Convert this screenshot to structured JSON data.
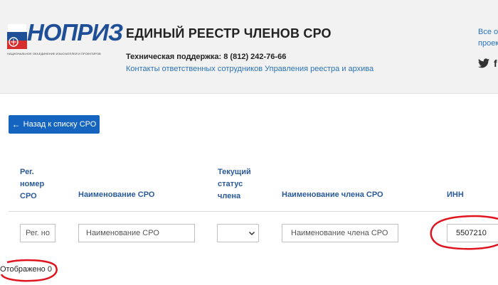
{
  "header": {
    "logo": {
      "wordmark": "НОПРИЗ",
      "subtitle": "НАЦИОНАЛЬНОЕ ОБЪЕДИНЕНИЕ ИЗЫСКАТЕЛЕЙ И ПРОЕКТИРОВЩИКОВ"
    },
    "title": "ЕДИНЫЙ РЕЕСТР ЧЛЕНОВ СРО",
    "support": "Техническая поддержка: 8 (812) 242-76-66",
    "contacts_link": "Контакты ответственных сотрудников Управления реестра и архива",
    "right_link_line1": "Все ор",
    "right_link_line2": "проек",
    "social": [
      "twitter-icon",
      "facebook-icon"
    ]
  },
  "back_button": {
    "label": "Назад к списку СРО",
    "icon": "arrow-left-icon"
  },
  "table": {
    "headers": {
      "reg_number": "Рег. номер СРО",
      "sro_name": "Наименование СРО",
      "member_status": "Текущий статус члена",
      "member_name": "Наименование члена СРО",
      "inn": "ИНН"
    },
    "filters": {
      "reg_number_placeholder": "Рег. но",
      "sro_name_placeholder": "Наименование СРО",
      "status_selected": "",
      "member_name_placeholder": "Наименование члена СРО",
      "inn_value": "5507210"
    }
  },
  "footer": {
    "shown_text": "Отображено 0"
  },
  "colors": {
    "header_bg": "#f2f2f2",
    "accent_blue": "#1565c0",
    "link_blue": "#2a73b8",
    "header_text_blue": "#2a5a99",
    "annotation_red": "#e0141e"
  }
}
